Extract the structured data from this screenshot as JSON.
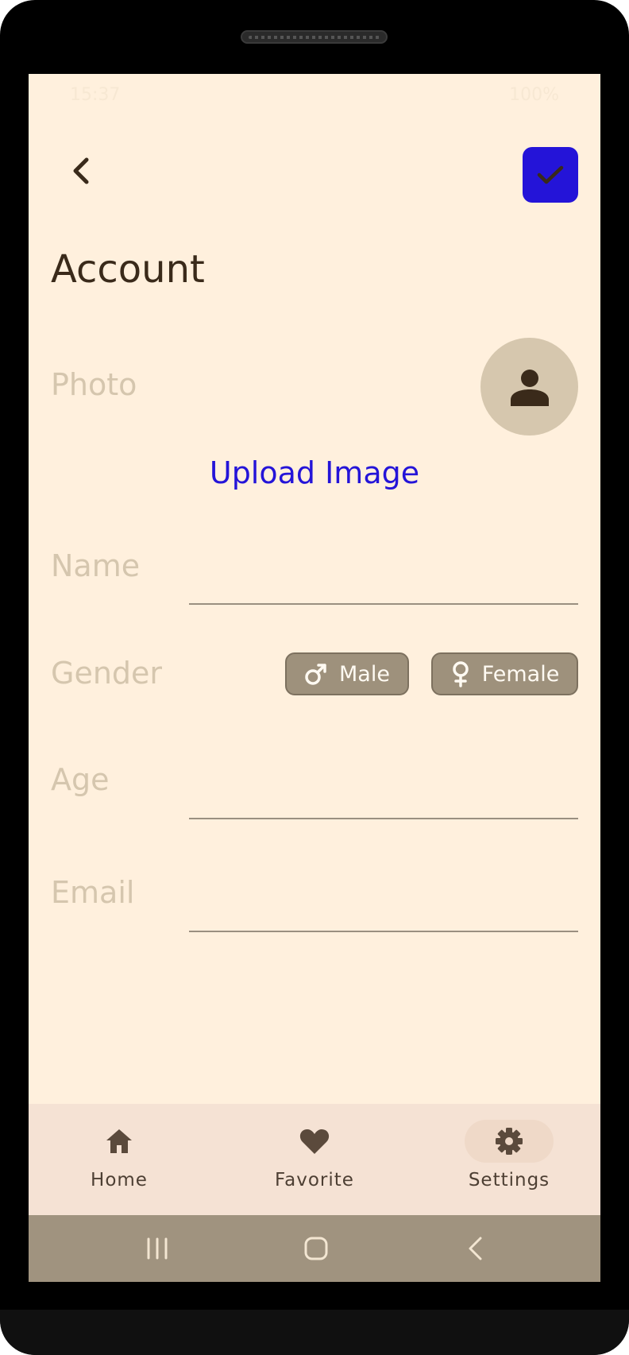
{
  "status_bar": {
    "time": "15:37",
    "right": "100%"
  },
  "header": {
    "back_icon": "chevron-left-icon",
    "save_icon": "check-icon",
    "accent_color": "#2414d8"
  },
  "page": {
    "title": "Account"
  },
  "photo": {
    "label": "Photo",
    "avatar_icon": "person-icon",
    "upload_label": "Upload Image"
  },
  "form": {
    "name_label": "Name",
    "name_value": "",
    "gender_label": "Gender",
    "gender_options": [
      {
        "label": "Male",
        "icon": "male-icon"
      },
      {
        "label": "Female",
        "icon": "female-icon"
      }
    ],
    "age_label": "Age",
    "age_value": "",
    "email_label": "Email",
    "email_value": ""
  },
  "bottom_nav": {
    "items": [
      {
        "label": "Home",
        "icon": "home-icon"
      },
      {
        "label": "Favorite",
        "icon": "heart-icon"
      },
      {
        "label": "Settings",
        "icon": "gear-icon",
        "active": true
      }
    ]
  },
  "system_nav": {
    "recent_icon": "recents-icon",
    "home_icon": "home-circle-icon",
    "back_icon": "back-icon"
  }
}
